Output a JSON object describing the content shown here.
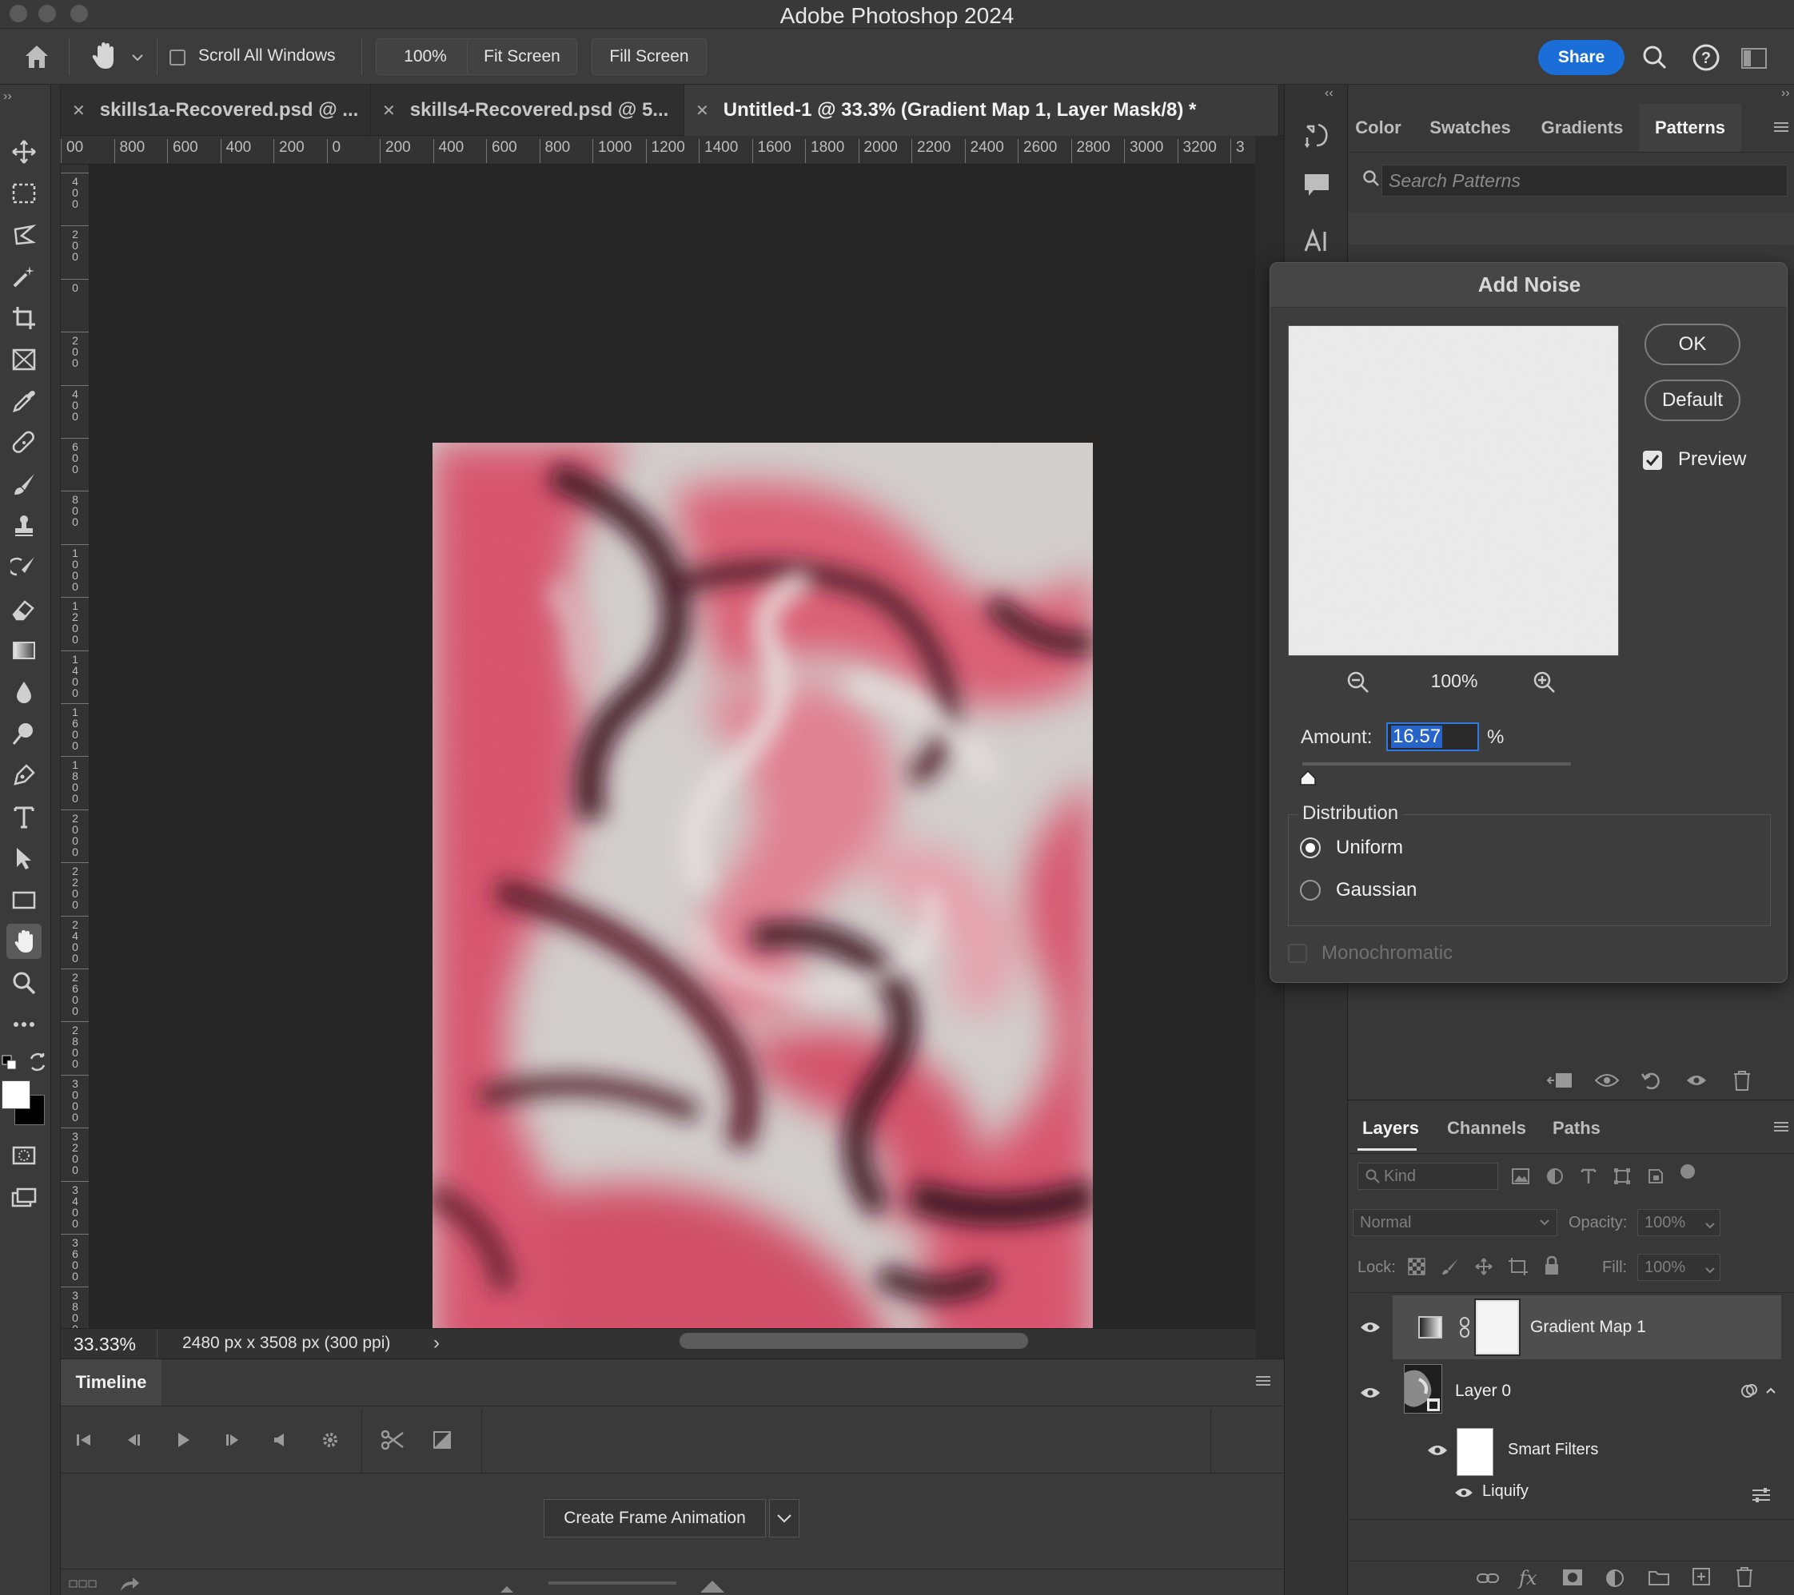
{
  "app": {
    "title": "Adobe Photoshop 2024"
  },
  "options_bar": {
    "scroll_all_windows": "Scroll All Windows",
    "zoom_100": "100%",
    "fit_screen": "Fit Screen",
    "fill_screen": "Fill Screen",
    "share": "Share"
  },
  "tabs": [
    {
      "label": "skills1a-Recovered.psd @ ..."
    },
    {
      "label": "skills4-Recovered.psd @ 5..."
    },
    {
      "label": "Untitled-1 @ 33.3% (Gradient Map 1, Layer Mask/8) *"
    }
  ],
  "ruler": {
    "horizontal": [
      "00",
      "800",
      "600",
      "400",
      "200",
      "0",
      "200",
      "400",
      "600",
      "800",
      "1000",
      "1200",
      "1400",
      "1600",
      "1800",
      "2000",
      "2200",
      "2400",
      "2600",
      "2800",
      "3000",
      "3200",
      "3"
    ],
    "vertical": [
      "400",
      "200",
      "0",
      "200",
      "400",
      "600",
      "800",
      "1000",
      "1200",
      "1400",
      "1600",
      "1800",
      "2000",
      "2200",
      "2400",
      "2600",
      "2800",
      "3000",
      "3200",
      "3400",
      "3600",
      "3800"
    ]
  },
  "status": {
    "zoom": "33.33%",
    "doc_size": "2480 px x 3508 px (300 ppi)",
    "arrow": "›"
  },
  "timeline": {
    "title": "Timeline",
    "create_frame_animation": "Create Frame Animation"
  },
  "patterns_panel": {
    "tabs": [
      "Color",
      "Swatches",
      "Gradients",
      "Patterns"
    ],
    "active_tab": "Patterns",
    "search_placeholder": "Search Patterns"
  },
  "add_noise": {
    "title": "Add Noise",
    "ok": "OK",
    "default": "Default",
    "preview_label": "Preview",
    "preview_checked": true,
    "zoom": "100%",
    "amount_label": "Amount:",
    "amount_value": "16.57",
    "amount_unit": "%",
    "distribution_label": "Distribution",
    "uniform": "Uniform",
    "gaussian": "Gaussian",
    "selected_distribution": "Uniform",
    "monochromatic": "Monochromatic",
    "monochromatic_checked": false
  },
  "layers_panel": {
    "tabs": [
      "Layers",
      "Channels",
      "Paths"
    ],
    "active_tab": "Layers",
    "kind_placeholder": "Kind",
    "blend_mode": "Normal",
    "opacity_label": "Opacity:",
    "opacity_value": "100%",
    "lock_label": "Lock:",
    "fill_label": "Fill:",
    "fill_value": "100%",
    "layers": [
      {
        "name": "Gradient Map 1"
      },
      {
        "name": "Layer 0"
      },
      {
        "name": "Smart Filters"
      },
      {
        "name": "Liquify"
      }
    ]
  },
  "colors": {
    "accent": "#1b6ed8",
    "artwork_pink": "#d9506a",
    "artwork_dark": "#3a0f1c",
    "artwork_light": "#d2cfce"
  }
}
